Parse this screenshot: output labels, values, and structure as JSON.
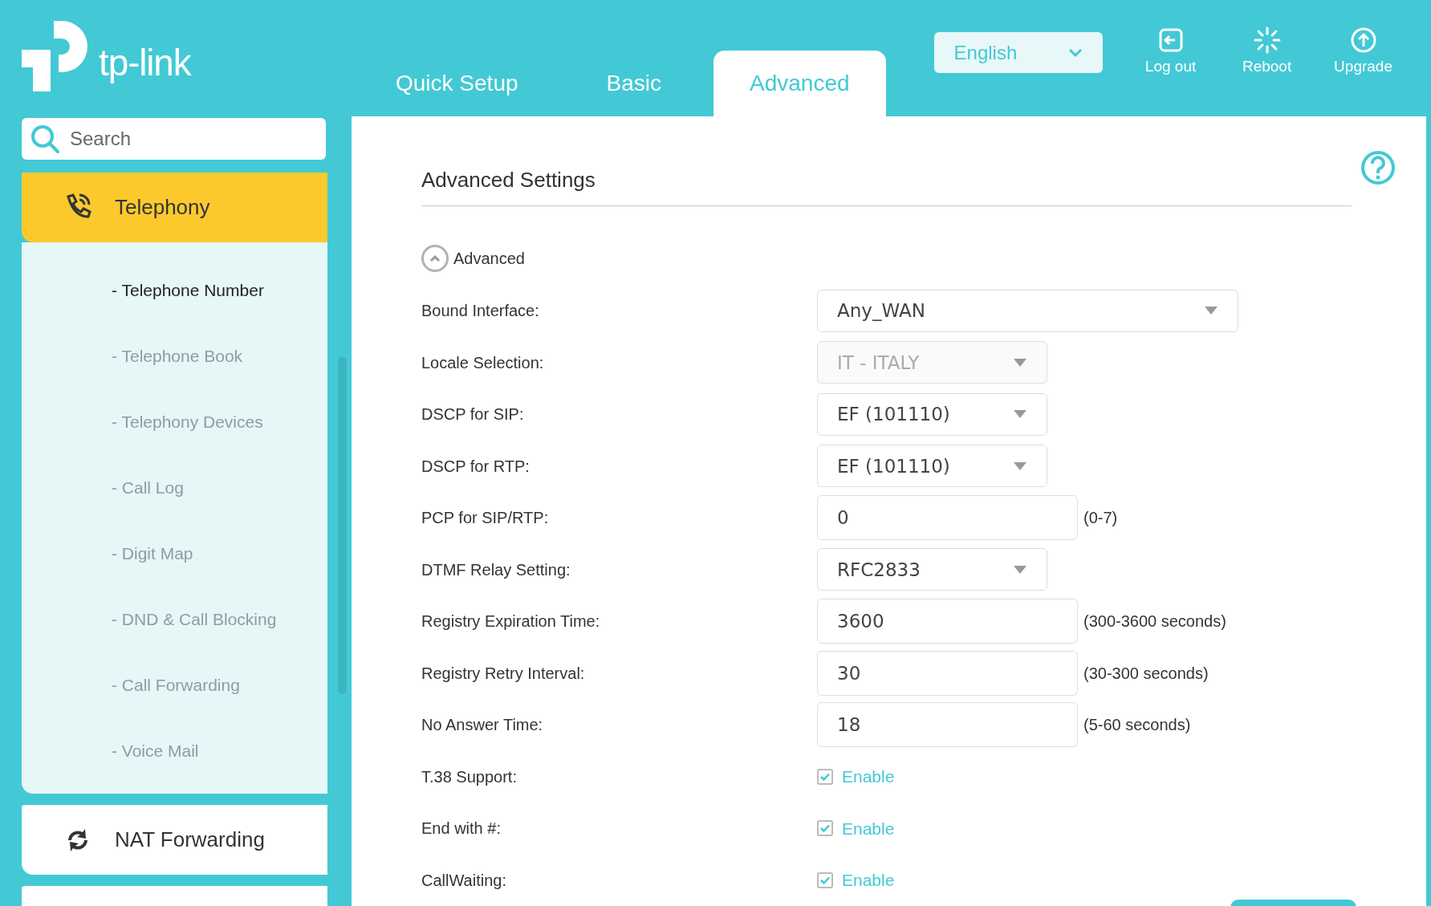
{
  "header": {
    "logo_text": "tp-link",
    "tabs": [
      {
        "label": "Quick Setup",
        "selected": false
      },
      {
        "label": "Basic",
        "selected": false
      },
      {
        "label": "Advanced",
        "selected": true
      }
    ],
    "language": "English",
    "actions": [
      {
        "kind": "logout",
        "label": "Log out"
      },
      {
        "kind": "reboot",
        "label": "Reboot"
      },
      {
        "kind": "upgrade",
        "label": "Upgrade"
      }
    ]
  },
  "sidebar": {
    "search": {
      "placeholder": "Search"
    },
    "sections": [
      {
        "kind": "phone",
        "label": "Telephony",
        "selected": true,
        "expanded": true,
        "children": [
          {
            "label": "- Telephone Number",
            "selected": true
          },
          {
            "label": "- Telephone Book",
            "selected": false
          },
          {
            "label": "- Telephony Devices",
            "selected": false
          },
          {
            "label": "- Call Log",
            "selected": false
          },
          {
            "label": "- Digit Map",
            "selected": false
          },
          {
            "label": "- DND & Call Blocking",
            "selected": false
          },
          {
            "label": "- Call Forwarding",
            "selected": false
          },
          {
            "label": "- Voice Mail",
            "selected": false
          }
        ]
      },
      {
        "kind": "nat",
        "label": "NAT Forwarding",
        "selected": false,
        "expanded": false
      }
    ]
  },
  "main": {
    "title": "Advanced Settings",
    "section_toggle": {
      "label": "Advanced",
      "expanded": true
    },
    "fields": [
      {
        "kind": "select",
        "label": "Bound Interface:",
        "value": "Any_WAN",
        "wide": true,
        "disabled": false
      },
      {
        "kind": "select",
        "label": "Locale Selection:",
        "value": "IT - ITALY",
        "wide": false,
        "disabled": true
      },
      {
        "kind": "select",
        "label": "DSCP for SIP:",
        "value": "EF (101110)",
        "wide": false,
        "disabled": false
      },
      {
        "kind": "select",
        "label": "DSCP for RTP:",
        "value": "EF (101110)",
        "wide": false,
        "disabled": false
      },
      {
        "kind": "input",
        "label": "PCP for SIP/RTP:",
        "value": "0",
        "hint": "(0-7)"
      },
      {
        "kind": "select",
        "label": "DTMF Relay Setting:",
        "value": "RFC2833",
        "wide": false,
        "disabled": false
      },
      {
        "kind": "input",
        "label": "Registry Expiration Time:",
        "value": "3600",
        "hint": "(300-3600 seconds)"
      },
      {
        "kind": "input",
        "label": "Registry Retry Interval:",
        "value": "30",
        "hint": "(30-300 seconds)"
      },
      {
        "kind": "input",
        "label": "No Answer Time:",
        "value": "18",
        "hint": "(5-60 seconds)"
      },
      {
        "kind": "checkbox",
        "label": "T.38 Support:",
        "option": "Enable",
        "checked": true
      },
      {
        "kind": "checkbox",
        "label": "End with #:",
        "option": "Enable",
        "checked": true
      },
      {
        "kind": "checkbox",
        "label": "CallWaiting:",
        "option": "Enable",
        "checked": true
      }
    ]
  }
}
